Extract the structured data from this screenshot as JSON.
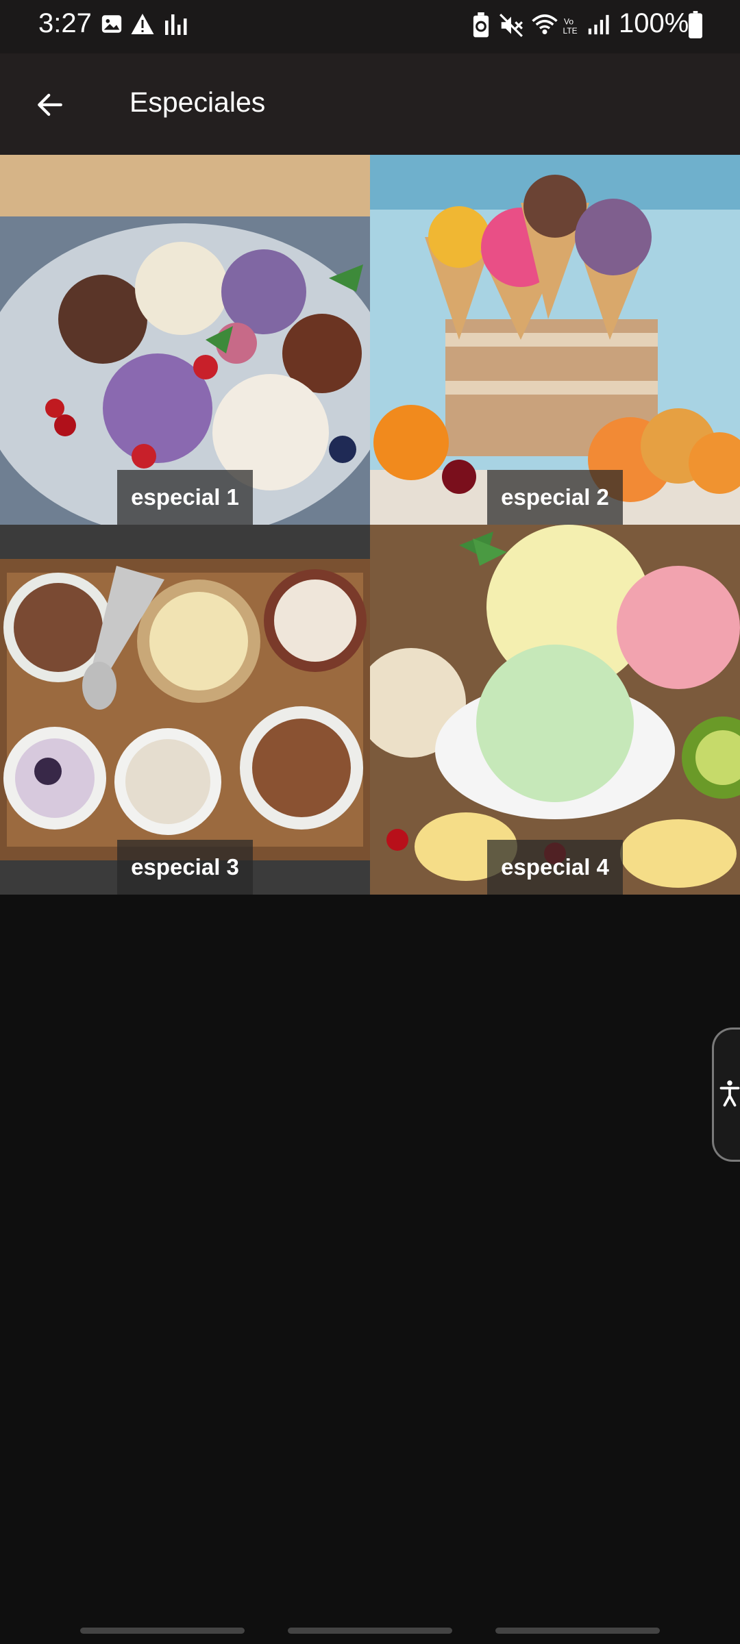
{
  "status_bar": {
    "time": "3:27",
    "battery_text": "100%",
    "icons": [
      "gallery-icon",
      "warning-icon",
      "signal-bars-icon",
      "battery-saver-icon",
      "mute-icon",
      "wifi-icon",
      "volte-icon",
      "cell-signal-icon",
      "battery-icon"
    ]
  },
  "app_bar": {
    "title": "Especiales",
    "back_icon": "arrow-left-icon"
  },
  "grid": {
    "items": [
      {
        "label": "especial 1"
      },
      {
        "label": "especial 2"
      },
      {
        "label": "especial 3"
      },
      {
        "label": "especial 4"
      }
    ]
  },
  "accessibility": {
    "icon": "accessibility-icon"
  },
  "colors": {
    "background": "#0f0f0f",
    "status_bar": "#1b1919",
    "app_bar": "#231f1f",
    "text": "#ffffff"
  }
}
